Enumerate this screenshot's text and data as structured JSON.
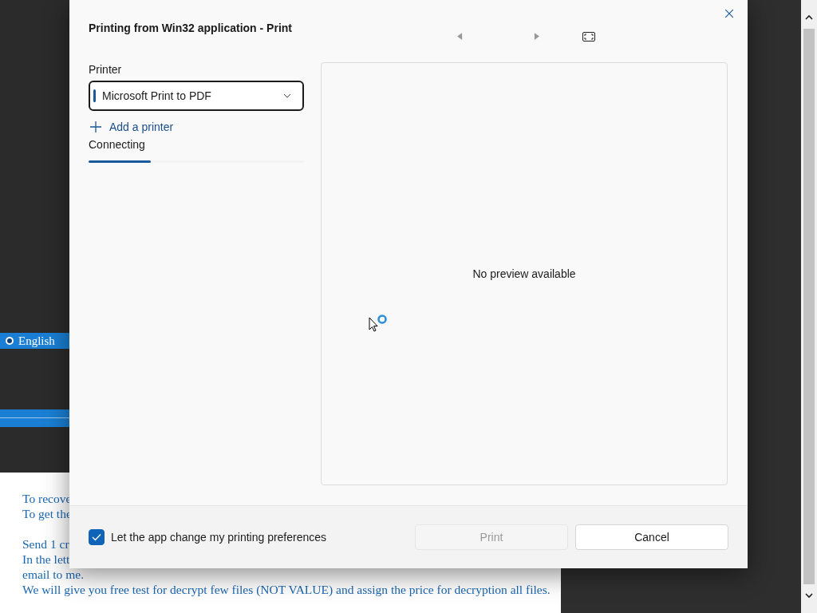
{
  "background": {
    "language_option": {
      "label": "English",
      "selected": true
    },
    "document_paragraphs": [
      [
        "To recove",
        "To get the"
      ],
      [
        "Send 1 cr",
        "In the lett",
        "email to me.",
        "We will give you free test for decrypt few files (NOT VALUE) and assign the price for decryption all files."
      ]
    ]
  },
  "dialog": {
    "title": "Printing from Win32 application - Print",
    "printer_label": "Printer",
    "printer": {
      "value": "Microsoft Print to PDF"
    },
    "add_printer": "Add a printer",
    "status": "Connecting",
    "progress": {
      "level": 0.29
    },
    "preview_message": "No preview available",
    "preferences_checkbox": {
      "label": "Let the app change my printing preferences",
      "checked": true
    },
    "buttons": [
      {
        "label": "Print",
        "disabled": true
      },
      {
        "label": "Cancel",
        "disabled": false
      }
    ]
  }
}
